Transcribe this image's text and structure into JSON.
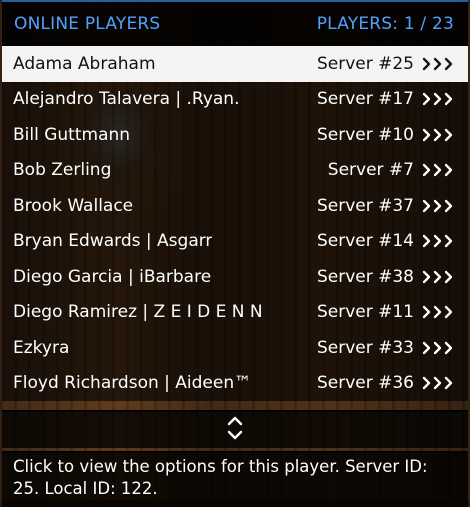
{
  "header": {
    "title": "ONLINE PLAYERS",
    "count": "PLAYERS: 1 / 23"
  },
  "players": [
    {
      "name": "Adama Abraham",
      "server": "Server #25"
    },
    {
      "name": "Alejandro Talavera | .Ryan.",
      "server": "Server #17"
    },
    {
      "name": "Bill Guttmann",
      "server": "Server #10"
    },
    {
      "name": "Bob Zerling",
      "server": "Server #7"
    },
    {
      "name": "Brook Wallace",
      "server": "Server #37"
    },
    {
      "name": "Bryan Edwards | Asgarr",
      "server": "Server #14"
    },
    {
      "name": "Diego Garcia | iBarbare",
      "server": "Server #38"
    },
    {
      "name": "Diego Ramirez | Z E I D E N N",
      "server": "Server #11"
    },
    {
      "name": "Ezkyra",
      "server": "Server #33"
    },
    {
      "name": "Floyd Richardson | Aideen™",
      "server": "Server #36"
    }
  ],
  "selected_index": 0,
  "description": "Click to view the options for this player. Server ID: 25. Local ID: 122.",
  "icons": {
    "row_arrow": "triple-chevron-right-icon",
    "scroll": "up-down-chevron-icon"
  },
  "colors": {
    "accent": "#4ea3ff",
    "selected_bg": "#f4f4f4"
  }
}
